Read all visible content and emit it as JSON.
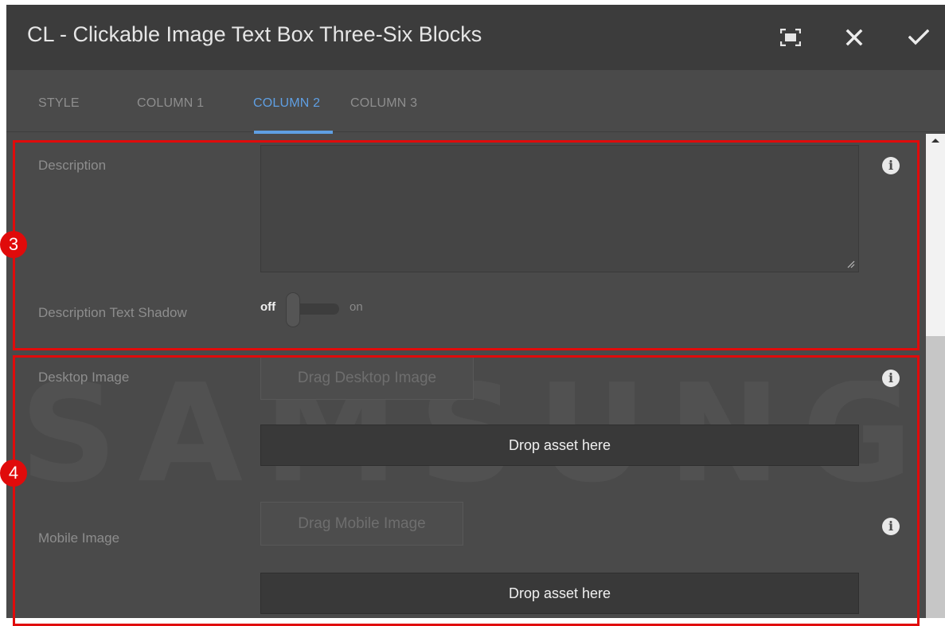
{
  "dialog": {
    "title": "CL - Clickable Image Text Box Three-Six Blocks",
    "toolbar_icons": [
      "fullscreen-icon",
      "close-icon",
      "checkmark-icon"
    ]
  },
  "tabs": [
    {
      "label": "STYLE",
      "active": false
    },
    {
      "label": "COLUMN 1",
      "active": false
    },
    {
      "label": "COLUMN 2",
      "active": true
    },
    {
      "label": "COLUMN 3",
      "active": false
    }
  ],
  "form": {
    "description": {
      "label": "Description",
      "value": ""
    },
    "description_text_shadow": {
      "label": "Description Text Shadow",
      "off_label": "off",
      "on_label": "on",
      "state": "off"
    },
    "desktop_image": {
      "label": "Desktop Image",
      "drag_button": "Drag Desktop Image",
      "drop_zone": "Drop asset here"
    },
    "mobile_image": {
      "label": "Mobile Image",
      "drag_button": "Drag Mobile Image",
      "drop_zone": "Drop asset here"
    }
  },
  "annotations": {
    "badge_3": "3",
    "badge_4": "4",
    "highlight_color": "#e00b0b"
  },
  "watermark": "SAMSUNG",
  "colors": {
    "accent": "#5f9fe3",
    "panel": "#4a4a4a",
    "titlebar": "#3c3c3c"
  }
}
